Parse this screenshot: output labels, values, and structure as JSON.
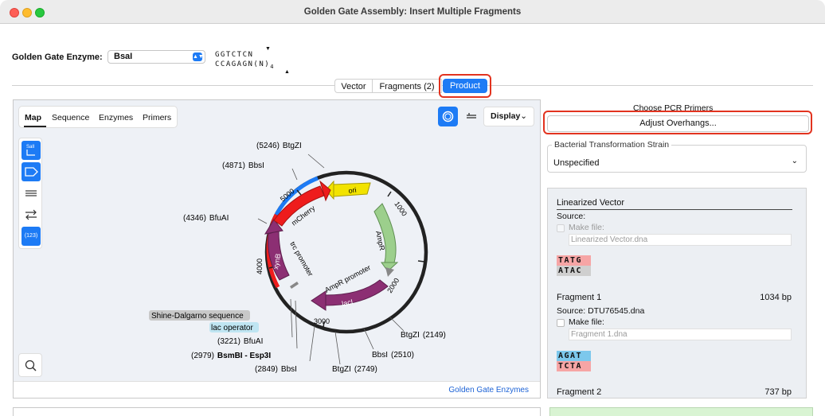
{
  "window": {
    "title": "Golden Gate Assembly: Insert Multiple Fragments"
  },
  "enzyme": {
    "label": "Golden Gate Enzyme:",
    "value": "BsaI",
    "site_top": "GGTCTCN",
    "site_bottom": "CCAGAGN(N)",
    "site_bottom_sub": "4"
  },
  "tabs": {
    "vector": "Vector",
    "fragments": "Fragments (2)",
    "product": "Product"
  },
  "map": {
    "view_tabs": [
      "Map",
      "Sequence",
      "Enzymes",
      "Primers"
    ],
    "display_label": "Display",
    "toolbar_tag_label": "SalI",
    "toolbar_number_label": "(123)",
    "footer_link": "Golden Gate Enzymes",
    "position_ticks": [
      "1000",
      "2000",
      "3000",
      "4000",
      "5000"
    ],
    "features": [
      "ori",
      "AmpR",
      "AmpR promoter",
      "lacI",
      "trc promoter",
      "xynB",
      "mCherry"
    ],
    "sites": [
      {
        "pos": "(5246)",
        "name": "BtgZI"
      },
      {
        "pos": "(4871)",
        "name": "BbsI"
      },
      {
        "pos": "(4346)",
        "name": "BfuAI"
      },
      {
        "pos": "(3221)",
        "name": "BfuAI"
      },
      {
        "pos": "(2979)",
        "name": "BsmBI - Esp3I"
      },
      {
        "pos": "(2849)",
        "name": "BbsI"
      },
      {
        "pos": "(2749)",
        "name": "BtgZI"
      },
      {
        "pos": "(2510)",
        "name": "BbsI"
      },
      {
        "pos": "(2149)",
        "name": "BtgZI"
      }
    ],
    "labels": {
      "shine_dalgarno": "Shine-Dalgarno sequence",
      "lac_operator": "lac operator"
    }
  },
  "right": {
    "choose_primers": "Choose PCR Primers",
    "adjust_button": "Adjust Overhangs...",
    "strain_legend": "Bacterial Transformation Strain",
    "strain_value": "Unspecified",
    "linearized": {
      "title": "Linearized Vector",
      "source_label": "Source:",
      "make_file": "Make file:",
      "file_placeholder": "Linearized Vector.dna",
      "overhang_top": "TATG",
      "overhang_bottom": "ATAC"
    },
    "fragment1": {
      "title": "Fragment 1",
      "size": "1034 bp",
      "source": "Source:  DTU76545.dna",
      "make_file": "Make file:",
      "file_placeholder": "Fragment 1.dna",
      "overhang_top": "AGAT",
      "overhang_bottom": "TCTA"
    },
    "fragment2": {
      "title": "Fragment 2",
      "size": "737 bp"
    }
  },
  "colors": {
    "accent": "#1d7bf5",
    "highlight": "#e2331f",
    "mcherry": "#ee1c1c",
    "xynB": "#8c2f73",
    "ampR": "#9ccf8c",
    "ori": "#f2e300"
  }
}
